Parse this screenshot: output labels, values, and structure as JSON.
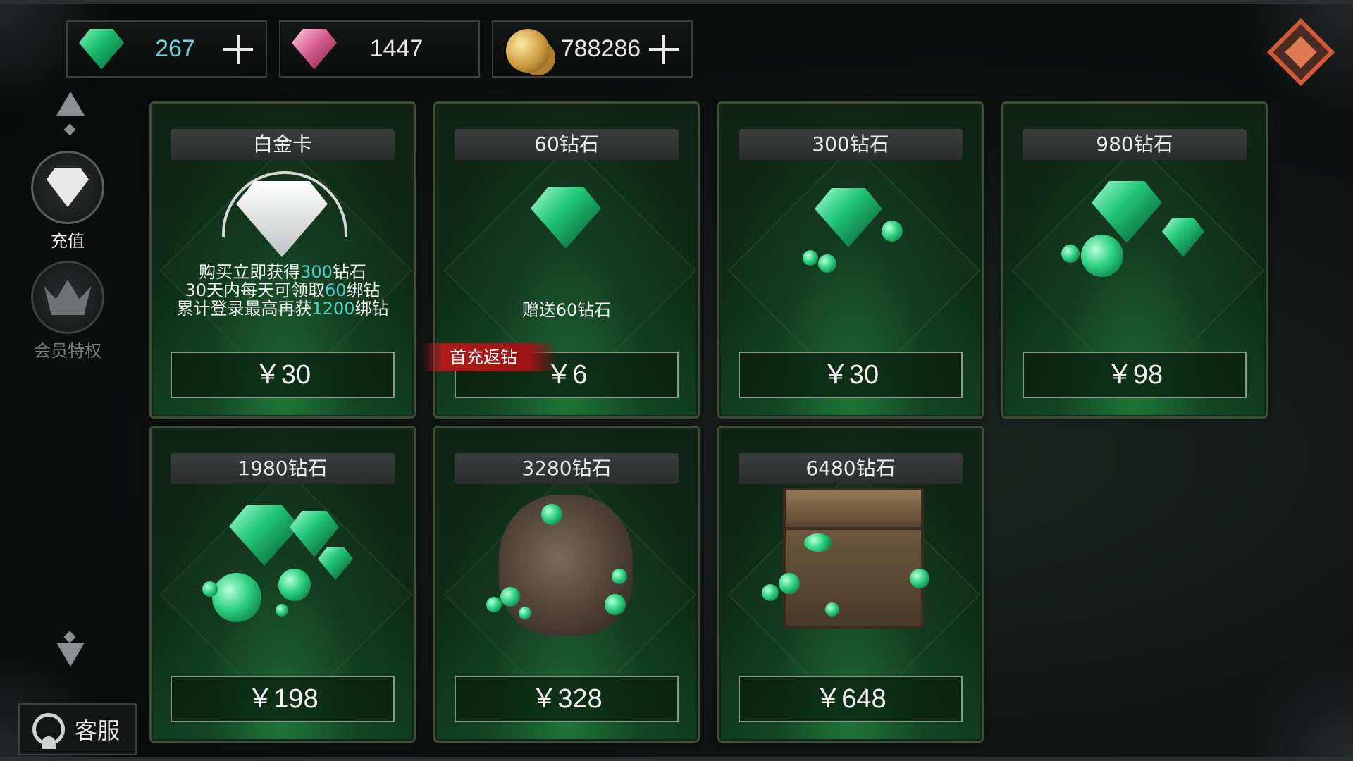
{
  "currencies": [
    {
      "name": "green-diamond",
      "value": "267",
      "value_color": "#6fd3d8",
      "has_plus": true
    },
    {
      "name": "pink-diamond",
      "value": "1447",
      "value_color": "#e8e8e8",
      "has_plus": false
    },
    {
      "name": "gold",
      "value": "788286",
      "value_color": "#e8e8e8",
      "has_plus": true
    }
  ],
  "sidebar": {
    "items": [
      {
        "label": "充值",
        "icon": "diamond-icon",
        "active": true
      },
      {
        "label": "会员特权",
        "icon": "crown-icon",
        "active": false
      }
    ]
  },
  "customer_service": {
    "label": "客服",
    "icon": "headset-icon"
  },
  "colors": {
    "highlight": "#4fd0cf",
    "card_border": "#3d4f35",
    "ribbon": "#b01a1a"
  },
  "products": [
    {
      "title": "白金卡",
      "price": "￥30",
      "desc": {
        "line1_pre": "购买立即获得",
        "line1_hl": "300",
        "line1_post": "钻石",
        "line2_pre": "30天内每天可领取",
        "line2_hl": "60",
        "line2_post": "绑钻",
        "line3_pre": "累计登录最高再获",
        "line3_hl": "1200",
        "line3_post": "绑钻"
      }
    },
    {
      "title": "60钻石",
      "price": "￥6",
      "bonus": "赠送60钻石",
      "ribbon": "首充返钻"
    },
    {
      "title": "300钻石",
      "price": "￥30"
    },
    {
      "title": "980钻石",
      "price": "￥98"
    },
    {
      "title": "1980钻石",
      "price": "￥198"
    },
    {
      "title": "3280钻石",
      "price": "￥328"
    },
    {
      "title": "6480钻石",
      "price": "￥648"
    }
  ]
}
